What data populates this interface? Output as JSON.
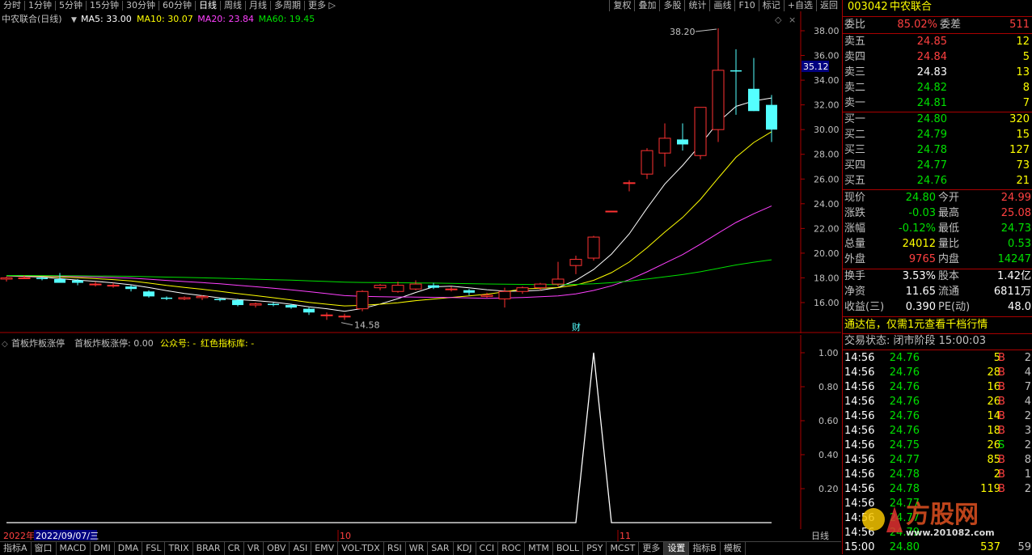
{
  "toolbar": {
    "timeframes": [
      "分时",
      "1分钟",
      "5分钟",
      "15分钟",
      "30分钟",
      "60分钟",
      "日线",
      "周线",
      "月线",
      "多周期",
      "更多 ▷"
    ],
    "active_timeframe": "日线",
    "buttons": [
      "复权",
      "叠加",
      "多股",
      "统计",
      "画线",
      "F10",
      "标记",
      "+自选",
      "返回"
    ]
  },
  "main_chart": {
    "title": "中农联合(日线)",
    "ma": [
      {
        "label": "MA5: 33.00",
        "color": "#ffffff"
      },
      {
        "label": "MA10: 30.07",
        "color": "#ffff00"
      },
      {
        "label": "MA20: 23.84",
        "color": "#ff40ff"
      },
      {
        "label": "MA60: 19.45",
        "color": "#00e000"
      }
    ],
    "price_ticks": [
      "38.00",
      "36.00",
      "34.00",
      "32.00",
      "30.00",
      "28.00",
      "26.00",
      "24.00",
      "22.00",
      "20.00",
      "18.00",
      "16.00"
    ],
    "current_price_label": "35.12",
    "high_annotation": "38.20",
    "low_annotation": "14.58",
    "event_marker": "财"
  },
  "indicator": {
    "name": "首板炸板涨停",
    "value_label": "首板炸板涨停: 0.00",
    "gzh_label": "公众号: -",
    "lib_label": "红色指标库: -",
    "ticks": [
      "1.00",
      "0.80",
      "0.60",
      "0.40",
      "0.20"
    ]
  },
  "chart_data": {
    "type": "candlestick",
    "note_ylim": [
      14,
      39
    ],
    "candles": [
      [
        17.9,
        18.1,
        17.7,
        18.0
      ],
      [
        18.0,
        18.2,
        17.9,
        18.0
      ],
      [
        18.0,
        18.1,
        17.8,
        17.9
      ],
      [
        17.9,
        18.4,
        17.7,
        17.6
      ],
      [
        17.8,
        17.9,
        17.4,
        17.6
      ],
      [
        17.5,
        17.7,
        17.3,
        17.5
      ],
      [
        17.4,
        17.6,
        17.2,
        17.4
      ],
      [
        17.3,
        17.4,
        16.9,
        17.1
      ],
      [
        16.9,
        17.0,
        16.4,
        16.5
      ],
      [
        16.4,
        16.5,
        16.2,
        16.3
      ],
      [
        16.3,
        16.5,
        16.2,
        16.4
      ],
      [
        16.4,
        16.6,
        16.2,
        16.5
      ],
      [
        16.3,
        16.4,
        16.1,
        16.2
      ],
      [
        16.2,
        16.3,
        15.7,
        15.8
      ],
      [
        15.8,
        16.0,
        15.6,
        15.9
      ],
      [
        15.9,
        16.0,
        15.7,
        15.8
      ],
      [
        15.8,
        15.9,
        15.5,
        15.6
      ],
      [
        15.5,
        15.6,
        15.0,
        15.2
      ],
      [
        15.0,
        15.2,
        14.6,
        15.0
      ],
      [
        14.9,
        15.1,
        14.6,
        14.9
      ],
      [
        15.5,
        17.0,
        15.3,
        16.9
      ],
      [
        17.2,
        17.5,
        17.0,
        17.4
      ],
      [
        16.9,
        17.7,
        16.8,
        17.4
      ],
      [
        17.1,
        17.8,
        17.0,
        17.5
      ],
      [
        17.4,
        17.6,
        17.1,
        17.2
      ],
      [
        17.1,
        17.3,
        16.9,
        17.1
      ],
      [
        17.0,
        17.1,
        16.6,
        16.8
      ],
      [
        16.5,
        16.8,
        16.4,
        16.6
      ],
      [
        16.3,
        17.2,
        15.6,
        16.9
      ],
      [
        16.9,
        17.3,
        16.7,
        17.2
      ],
      [
        17.2,
        17.6,
        17.0,
        17.5
      ],
      [
        17.5,
        19.3,
        17.3,
        17.9
      ],
      [
        19.0,
        19.8,
        18.3,
        19.5
      ],
      [
        19.6,
        21.4,
        19.4,
        21.3
      ],
      [
        23.4,
        23.4,
        23.4,
        23.4
      ],
      [
        25.7,
        25.9,
        25.0,
        25.7
      ],
      [
        26.4,
        28.5,
        26.0,
        28.3
      ],
      [
        28.1,
        30.5,
        27.0,
        29.3
      ],
      [
        29.2,
        30.5,
        28.3,
        28.8
      ],
      [
        27.9,
        31.8,
        27.6,
        31.8
      ],
      [
        30.0,
        38.2,
        29.0,
        34.8
      ],
      [
        34.8,
        36.5,
        31.2,
        34.7
      ],
      [
        33.3,
        35.8,
        31.5,
        31.5
      ],
      [
        32.0,
        32.8,
        29.0,
        30.0
      ]
    ],
    "indicator_signal_index": 33
  },
  "date_axis": {
    "year_label": "2022年",
    "cursor_date": "2022/09/07/三",
    "month_labels": [
      "10",
      "11"
    ],
    "right_label": "日线"
  },
  "tabs": [
    "指标A",
    "窗口",
    "MACD",
    "DMI",
    "DMA",
    "FSL",
    "TRIX",
    "BRAR",
    "CR",
    "VR",
    "OBV",
    "ASI",
    "EMV",
    "VOL-TDX",
    "RSI",
    "WR",
    "SAR",
    "KDJ",
    "CCI",
    "ROC",
    "MTM",
    "BOLL",
    "PSY",
    "MCST",
    "更多",
    "设置",
    "指标B",
    "模板"
  ],
  "active_tab": "设置",
  "panel": {
    "code": "003042",
    "name": "中农联合",
    "weibi": {
      "label": "委比",
      "value": "85.02%",
      "diff_label": "委差",
      "diff": "511"
    },
    "asks": [
      {
        "label": "卖五",
        "price": "24.85",
        "vol": "12"
      },
      {
        "label": "卖四",
        "price": "24.84",
        "vol": "5"
      },
      {
        "label": "卖三",
        "price": "24.83",
        "vol": "13"
      },
      {
        "label": "卖二",
        "price": "24.82",
        "vol": "8"
      },
      {
        "label": "卖一",
        "price": "24.81",
        "vol": "7"
      }
    ],
    "bids": [
      {
        "label": "买一",
        "price": "24.80",
        "vol": "320"
      },
      {
        "label": "买二",
        "price": "24.79",
        "vol": "15"
      },
      {
        "label": "买三",
        "price": "24.78",
        "vol": "127"
      },
      {
        "label": "买四",
        "price": "24.77",
        "vol": "73"
      },
      {
        "label": "买五",
        "price": "24.76",
        "vol": "21"
      }
    ],
    "stats": [
      {
        "l1": "现价",
        "v1": "24.80",
        "l2": "今开",
        "v2": "24.99"
      },
      {
        "l1": "涨跌",
        "v1": "-0.03",
        "l2": "最高",
        "v2": "25.08"
      },
      {
        "l1": "涨幅",
        "v1": "-0.12%",
        "l2": "最低",
        "v2": "24.73"
      },
      {
        "l1": "总量",
        "v1": "24012",
        "l2": "量比",
        "v2": "0.53"
      },
      {
        "l1": "外盘",
        "v1": "9765",
        "l2": "内盘",
        "v2": "14247"
      }
    ],
    "stats2": [
      {
        "l1": "换手",
        "v1": "3.53%",
        "l2": "股本",
        "v2": "1.42亿"
      },
      {
        "l1": "净资",
        "v1": "11.65",
        "l2": "流通",
        "v2": "6811万"
      },
      {
        "l1": "收益(三)",
        "v1": "0.390",
        "l2": "PE(动)",
        "v2": "48.0"
      }
    ],
    "promo": "通达信，仅需1元查看千档行情",
    "trade_status": "交易状态: 闭市阶段 15:00:03",
    "ticks": [
      {
        "t": "14:56",
        "p": "24.76",
        "v": "5",
        "bs": "B",
        "n": "2"
      },
      {
        "t": "14:56",
        "p": "24.76",
        "v": "28",
        "bs": "B",
        "n": "4"
      },
      {
        "t": "14:56",
        "p": "24.76",
        "v": "16",
        "bs": "B",
        "n": "7"
      },
      {
        "t": "14:56",
        "p": "24.76",
        "v": "26",
        "bs": "B",
        "n": "4"
      },
      {
        "t": "14:56",
        "p": "24.76",
        "v": "14",
        "bs": "B",
        "n": "2"
      },
      {
        "t": "14:56",
        "p": "24.76",
        "v": "18",
        "bs": "B",
        "n": "3"
      },
      {
        "t": "14:56",
        "p": "24.75",
        "v": "26",
        "bs": "S",
        "n": "2"
      },
      {
        "t": "14:56",
        "p": "24.77",
        "v": "85",
        "bs": "B",
        "n": "8"
      },
      {
        "t": "14:56",
        "p": "24.78",
        "v": "2",
        "bs": "B",
        "n": "1"
      },
      {
        "t": "14:56",
        "p": "24.78",
        "v": "119",
        "bs": "B",
        "n": "2"
      },
      {
        "t": "14:56",
        "p": "24.77",
        "v": "",
        "bs": "",
        "n": ""
      },
      {
        "t": "14:56",
        "p": "24.77",
        "v": "",
        "bs": "",
        "n": ""
      },
      {
        "t": "14:56",
        "p": "24.79",
        "v": "",
        "bs": "",
        "n": ""
      },
      {
        "t": "15:00",
        "p": "24.80",
        "v": "537",
        "bs": "",
        "n": "59"
      }
    ],
    "watermark": "方股网",
    "watermark_url": "www.201082.com"
  }
}
